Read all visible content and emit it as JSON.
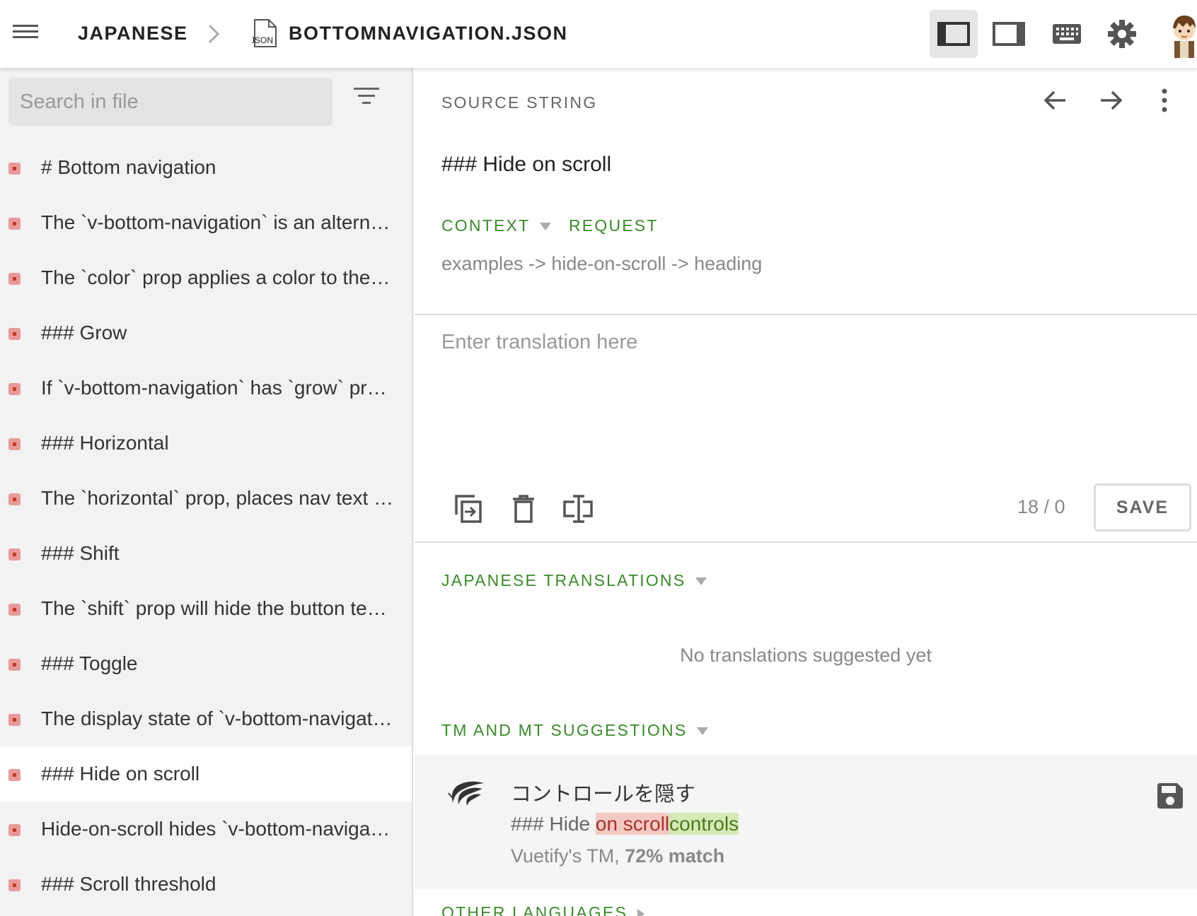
{
  "header": {
    "language": "JAPANESE",
    "file_icon_label": "JSON",
    "file_name": "BOTTOMNAVIGATION.JSON",
    "icons": [
      "menu-icon",
      "chevron-right-icon",
      "file-json-icon",
      "sidebar-layout-icon",
      "panel-layout-icon",
      "keyboard-icon",
      "gear-icon",
      "avatar"
    ]
  },
  "sidebar": {
    "search_placeholder": "Search in file",
    "items": [
      {
        "text": "# Bottom navigation"
      },
      {
        "text": "The `v-bottom-navigation` is an alterna…"
      },
      {
        "text": "The `color` prop applies a color to the …"
      },
      {
        "text": "### Grow"
      },
      {
        "text": "If `v-bottom-navigation` has `grow` pro…"
      },
      {
        "text": "### Horizontal"
      },
      {
        "text": "The `horizontal` prop, places nav text n…"
      },
      {
        "text": "### Shift"
      },
      {
        "text": "The `shift` prop will hide the button tex…"
      },
      {
        "text": "### Toggle"
      },
      {
        "text": "The display state of `v-bottom-navigati…"
      },
      {
        "text": "### Hide on scroll"
      },
      {
        "text": "Hide-on-scroll hides `v-bottom-navigati…"
      },
      {
        "text": "### Scroll threshold"
      }
    ],
    "selected_index": 11,
    "status_color": "#e89a9a"
  },
  "main": {
    "source_label": "SOURCE STRING",
    "source_text": "### Hide on scroll",
    "context_tab": "CONTEXT",
    "request_tab": "REQUEST",
    "context_text": "examples -> hide-on-scroll -> heading",
    "translation_placeholder": "Enter translation here",
    "counter": "18 / 0",
    "save_label": "SAVE",
    "translations_label": "JAPANESE TRANSLATIONS",
    "no_translations": "No translations suggested yet",
    "tm_label": "TM AND MT SUGGESTIONS",
    "suggestion": {
      "text": "コントロールを隠す",
      "diff_same": "### Hide ",
      "diff_removed": "on scroll",
      "diff_added": "controls",
      "source_prefix": "Vuetify's TM, ",
      "match": "72% match"
    },
    "other_label": "OTHER LANGUAGES",
    "accent_color": "#3a8a2a"
  }
}
